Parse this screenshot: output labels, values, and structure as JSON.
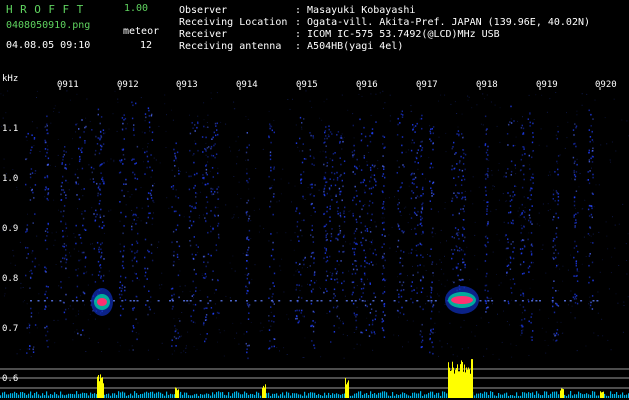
{
  "header": {
    "logo": "HROFFT",
    "version": "1.00",
    "filename": "0408050910.png",
    "datetime": "04.08.05 09:10",
    "meteor_label": "meteor",
    "meteor_count": "12",
    "fields": [
      {
        "label": "Observer",
        "value": ": Masayuki Kobayashi"
      },
      {
        "label": "Receiving Location",
        "value": ": Ogata-vill. Akita-Pref. JAPAN (139.96E, 40.02N)"
      },
      {
        "label": "Receiver",
        "value": ": ICOM IC-575 53.7492(@LCD)MHz USB"
      },
      {
        "label": "Receiving antenna",
        "value": ": A504HB(yagi 4el)"
      }
    ]
  },
  "axes": {
    "y_unit": "kHz",
    "y_ticks": [
      "1.1",
      "1.0",
      "0.9",
      "0.8",
      "0.7",
      "0.6"
    ],
    "x_ticks": [
      "0911",
      "0912",
      "0913",
      "0914",
      "0915",
      "0916",
      "0917",
      "0918",
      "0919",
      "0920"
    ]
  },
  "colors": {
    "background": "#000000",
    "header_green": "#5fd35f",
    "header_white": "#ffffff",
    "signal_blue": "#2040ff",
    "meteor_red": "#ff3070",
    "level_yellow": "#ffff00",
    "noise_cyan": "#00c8ff"
  }
}
